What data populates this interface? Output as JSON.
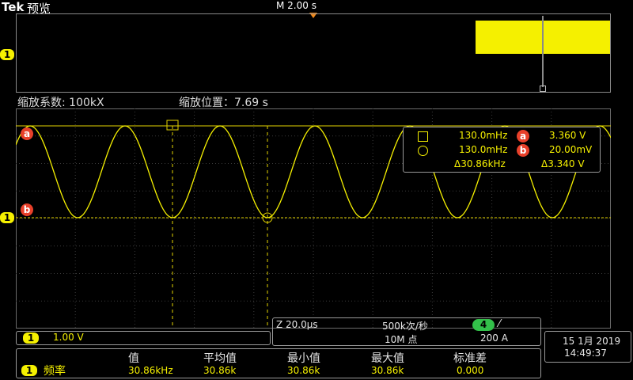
{
  "header": {
    "brand": "Tek",
    "mode": "预览",
    "timebase": "M 2.00 s"
  },
  "overview": {
    "channel_marker": "1"
  },
  "zoom_info": {
    "factor_label": "缩放系数: 100kX",
    "position_label": "缩放位置：7.69 s"
  },
  "cursor_readout": {
    "row_a": {
      "time": "130.0mHz",
      "badge": "a",
      "value": "3.360 V"
    },
    "row_b": {
      "time": "130.0mHz",
      "badge": "b",
      "value": "20.00mV"
    },
    "delta_time": "Δ30.86kHz",
    "delta_value": "Δ3.340 V"
  },
  "graticule_markers": {
    "cursor_a": "a",
    "cursor_b": "b",
    "channel": "1"
  },
  "channel_box": {
    "channel": "1",
    "scale": "1.00 V"
  },
  "horizontal_box": {
    "zoom_scale": "Z 20.0µs",
    "sample_rate": "500k次/秒",
    "record_length": "10M 点",
    "trigger_channel": "4",
    "trigger_slope": "⁄",
    "trigger_level": "200 A"
  },
  "datetime": {
    "date": "15 1月 2019",
    "time": "14:49:37"
  },
  "measurements": {
    "headers": [
      "值",
      "平均值",
      "最小值",
      "最大值",
      "标准差"
    ],
    "row": {
      "channel": "1",
      "name": "频率",
      "values": [
        "30.86kHz",
        "30.86k",
        "30.86k",
        "30.86k",
        "0.000"
      ]
    }
  },
  "colors": {
    "trace": "#f5f000",
    "cursor_badge": "#e8402a",
    "trigger_badge": "#33c04a"
  }
}
